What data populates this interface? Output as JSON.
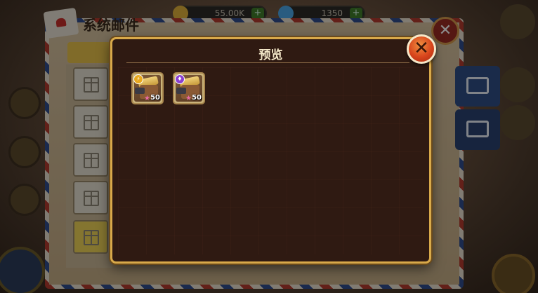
{
  "background": {
    "resources": [
      {
        "value": "55.00K",
        "icon": "coin-icon",
        "color": "#e2b23a"
      },
      {
        "value": "1350",
        "icon": "gem-icon",
        "color": "#4aa8e8"
      }
    ],
    "mail_window": {
      "title": "系统邮件"
    }
  },
  "preview": {
    "title": "预览",
    "close_icon": "close-x-icon",
    "items": [
      {
        "icon": "character-icon",
        "badge": "gold-rank-badge",
        "level": "50"
      },
      {
        "icon": "character-icon",
        "badge": "purple-rank-badge",
        "level": "50"
      }
    ]
  },
  "colors": {
    "modal_bg": "#2f1a12",
    "modal_border": "#d8a94a",
    "close_button": "#d8441c",
    "title_text": "#f3e7c8"
  }
}
